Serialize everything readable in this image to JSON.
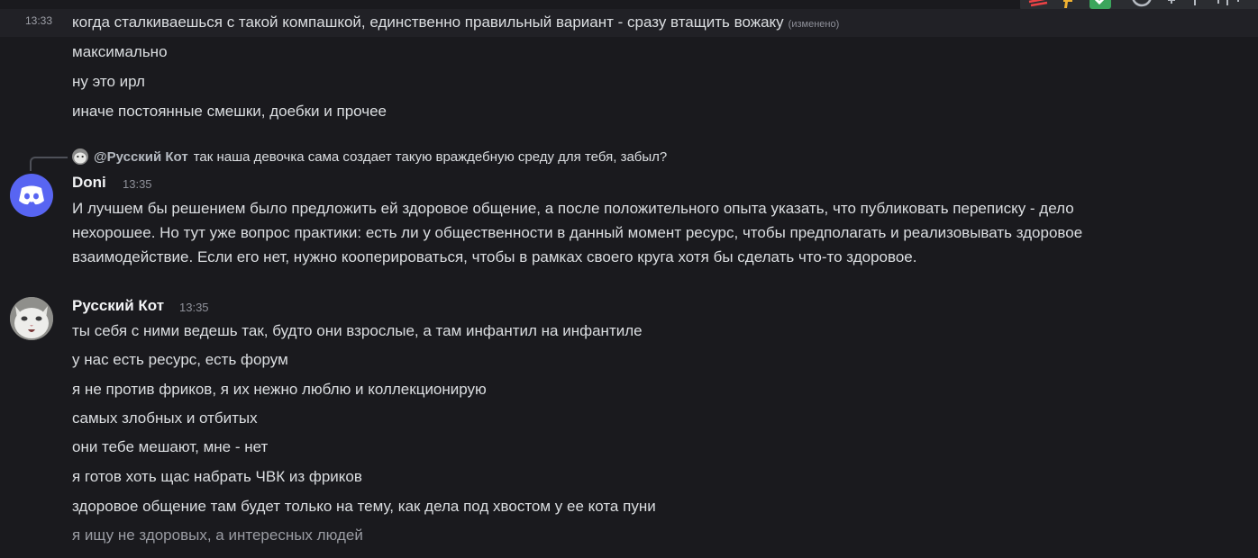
{
  "messages_top": {
    "timestamp": "13:33",
    "first_line": "когда сталкиваешься с такой компашкой, единственно правильный вариант - сразу втащить вожаку",
    "edited_label": "(изменено)",
    "lines": [
      "максимально",
      "ну это ирл",
      "иначе постоянные смешки, доебки и прочее"
    ]
  },
  "doni_message": {
    "reply": {
      "mention": "@Русский Кот",
      "text": "так наша девочка сама создает такую враждебную среду для тебя, забыл?"
    },
    "username": "Dоni",
    "timestamp": "13:35",
    "lines": [
      "И лучшем бы решением было предложить ей здоровое общение, а после положительного опыта указать, что публиковать переписку - дело",
      "нехорошее. Но тут уже вопрос практики: есть ли у общественности в данный момент ресурс, чтобы предполагать и реализовывать здоровое",
      "взаимодействие. Если его нет, нужно кооперироваться, чтобы в рамках своего круга хотя бы сделать что-то здоровое."
    ]
  },
  "cat_message": {
    "username": "Русский Кот",
    "timestamp": "13:35",
    "lines": [
      "ты себя с ними ведешь так, будто они взрослые, а там инфантил на инфантиле",
      "у нас есть ресурс, есть форум",
      "я не против фриков, я их нежно люблю и коллекционирую",
      "самых злобных и отбитых",
      "они тебе мешают, мне - нет",
      "я готов хоть щас набрать ЧВК из фриков",
      "здоровое общение там будет только на тему, как дела под хвостом у ее кота пуни",
      "я ищу не здоровых, а интересных людей"
    ]
  },
  "colors": {
    "background": "#1a1a1e",
    "hover_row": "#212126",
    "text": "#dbdee1",
    "discord_blurple": "#5865f2",
    "checkmark_green": "#3ba55c",
    "thumbs_yellow": "#f0b232",
    "red_icon": "#ed4245"
  },
  "icons": [
    "discord-logo-icon",
    "cat-avatar",
    "reaction-icon",
    "thumbs-up-icon",
    "checkmark-icon",
    "emoji-icon",
    "more-icon"
  ]
}
